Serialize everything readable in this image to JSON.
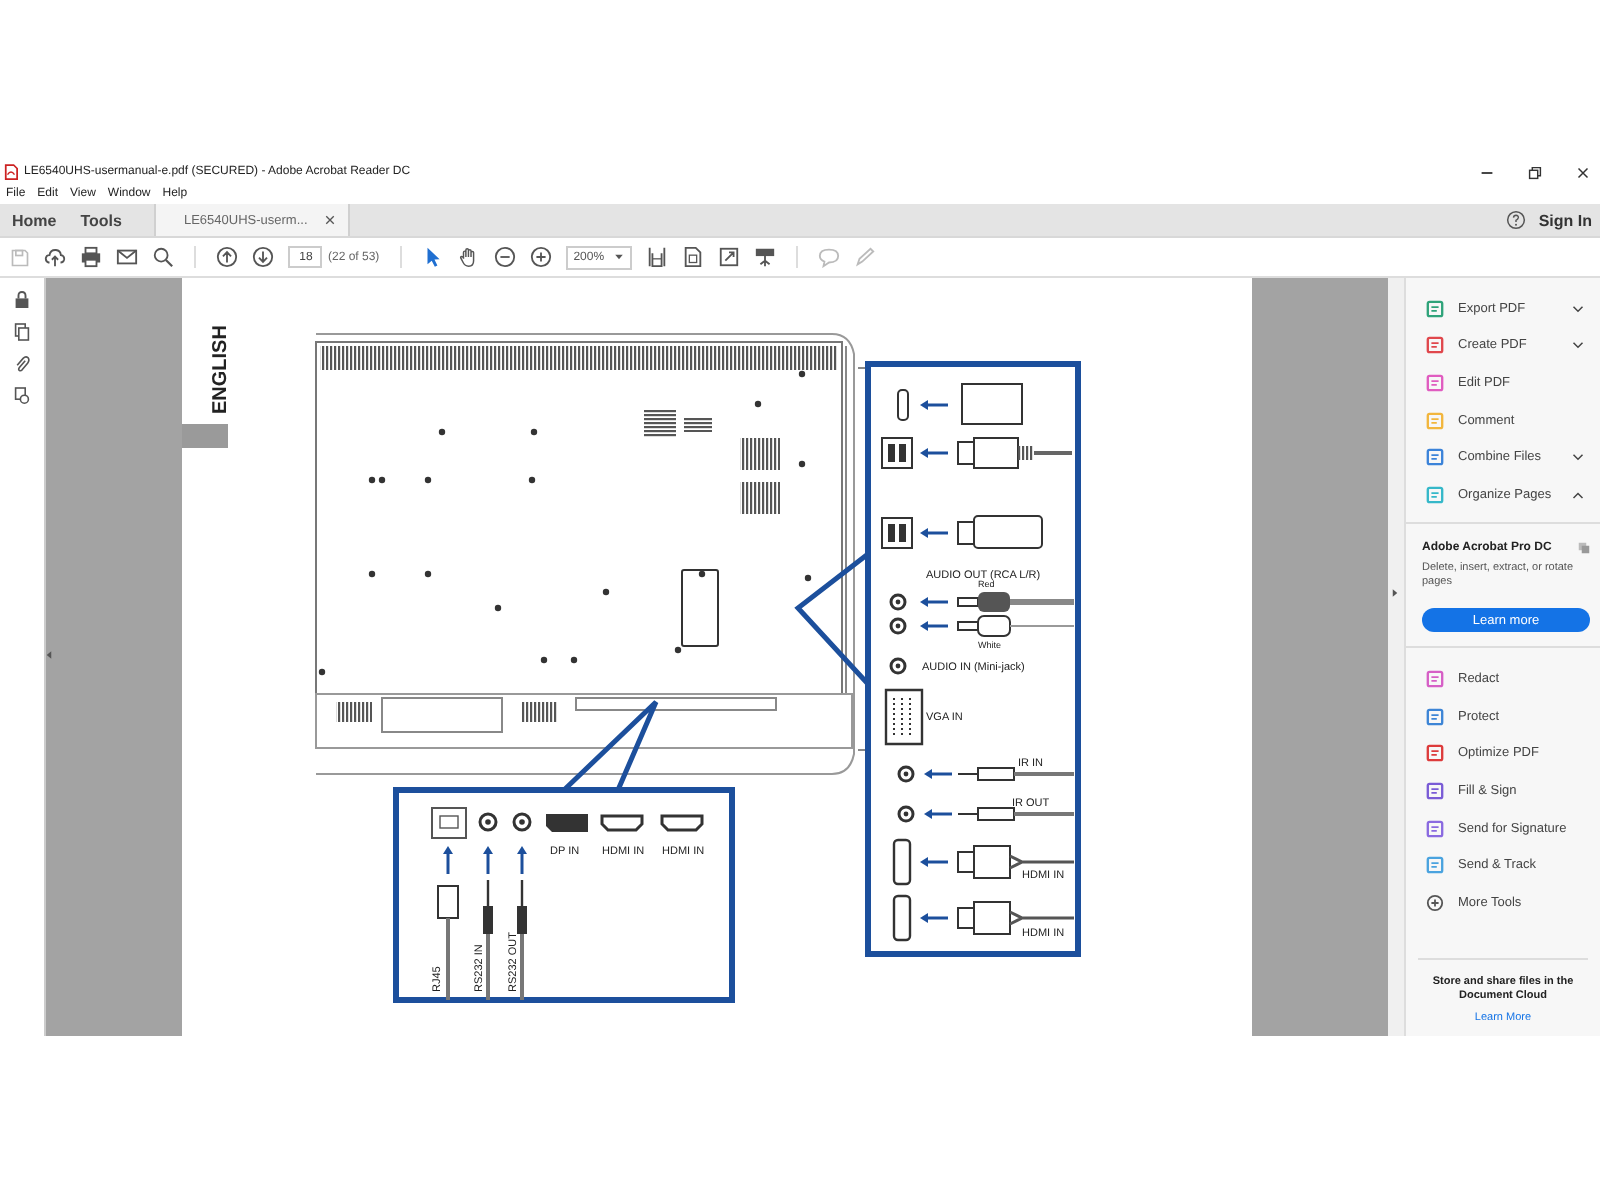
{
  "window": {
    "title": "LE6540UHS-usermanual-e.pdf (SECURED) - Adobe Acrobat Reader DC"
  },
  "menu": [
    "File",
    "Edit",
    "View",
    "Window",
    "Help"
  ],
  "tabs": [
    {
      "label": "Home",
      "selected": false
    },
    {
      "label": "Tools",
      "selected": false
    },
    {
      "label": "LE6540UHS-userm...",
      "selected": true
    }
  ],
  "account": {
    "sign_in": "Sign In"
  },
  "toolbar": {
    "page": "18",
    "page_count": "(22 of 53)",
    "zoom": "200%"
  },
  "document": {
    "language_tab": "ENGLISH",
    "bottom_panel_labels": [
      "DP IN",
      "HDMI IN",
      "HDMI IN"
    ],
    "cable_labels": [
      "RJ45",
      "RS232 IN",
      "RS232 OUT"
    ],
    "side_panel_labels": [
      "AUDIO OUT (RCA L/R)",
      "Red",
      "White",
      "AUDIO IN (Mini-jack)",
      "VGA IN",
      "IR IN",
      "IR OUT",
      "HDMI IN",
      "HDMI IN"
    ]
  },
  "tools_panel": {
    "tools": [
      {
        "label": "Export PDF",
        "color": "#2fa37a",
        "kind": "menu",
        "expanded": false
      },
      {
        "label": "Create PDF",
        "color": "#e0474c",
        "kind": "menu",
        "expanded": false
      },
      {
        "label": "Edit PDF",
        "color": "#e05cc0",
        "kind": "plain"
      },
      {
        "label": "Comment",
        "color": "#f2b63d",
        "kind": "plain"
      },
      {
        "label": "Combine Files",
        "color": "#3b83d9",
        "kind": "menu",
        "expanded": false
      },
      {
        "label": "Organize Pages",
        "color": "#35b8c9",
        "kind": "menu",
        "expanded": true
      }
    ],
    "promo": {
      "title": "Adobe Acrobat Pro DC",
      "text": "Delete, insert, extract, or rotate pages",
      "button": "Learn more"
    },
    "more_tools": [
      {
        "label": "Redact",
        "color": "#d65fc6",
        "kind": "tool"
      },
      {
        "label": "Protect",
        "color": "#3d85d6",
        "kind": "tool"
      },
      {
        "label": "Optimize PDF",
        "color": "#dd3b3b",
        "kind": "tool"
      },
      {
        "label": "Fill & Sign",
        "color": "#7a5cd6",
        "kind": "tool"
      },
      {
        "label": "Send for Signature",
        "color": "#8a6ae0",
        "kind": "tool"
      },
      {
        "label": "Send & Track",
        "color": "#4aa3df",
        "kind": "tool"
      },
      {
        "label": "More Tools",
        "color": "#555555",
        "kind": "more"
      }
    ],
    "cloud": {
      "text": "Store and share files in the Document Cloud",
      "link": "Learn More"
    }
  }
}
